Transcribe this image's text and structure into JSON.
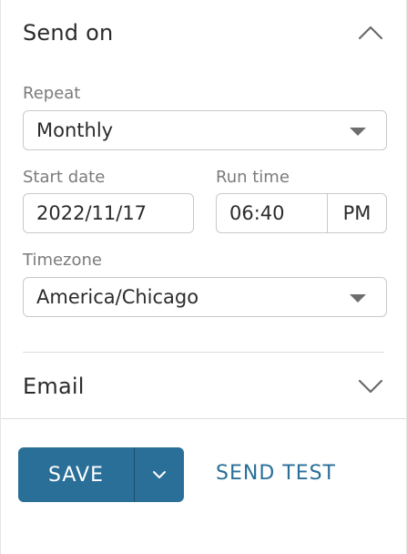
{
  "send_on": {
    "title": "Send on",
    "repeat": {
      "label": "Repeat",
      "value": "Monthly"
    },
    "start_date": {
      "label": "Start date",
      "value": "2022/11/17"
    },
    "run_time": {
      "label": "Run time",
      "value": "06:40",
      "period": "PM"
    },
    "timezone": {
      "label": "Timezone",
      "value": "America/Chicago"
    }
  },
  "email": {
    "title": "Email"
  },
  "actions": {
    "save_label": "SAVE",
    "send_test_label": "SEND TEST"
  },
  "colors": {
    "primary": "#2a6f98",
    "text": "#2b2b2b",
    "muted": "#7b7b7b",
    "border": "#c9c9c9"
  },
  "icons": {
    "send_on_toggle": "chevron-up-icon",
    "email_toggle": "chevron-down-icon",
    "save_menu": "chevron-down-icon"
  }
}
